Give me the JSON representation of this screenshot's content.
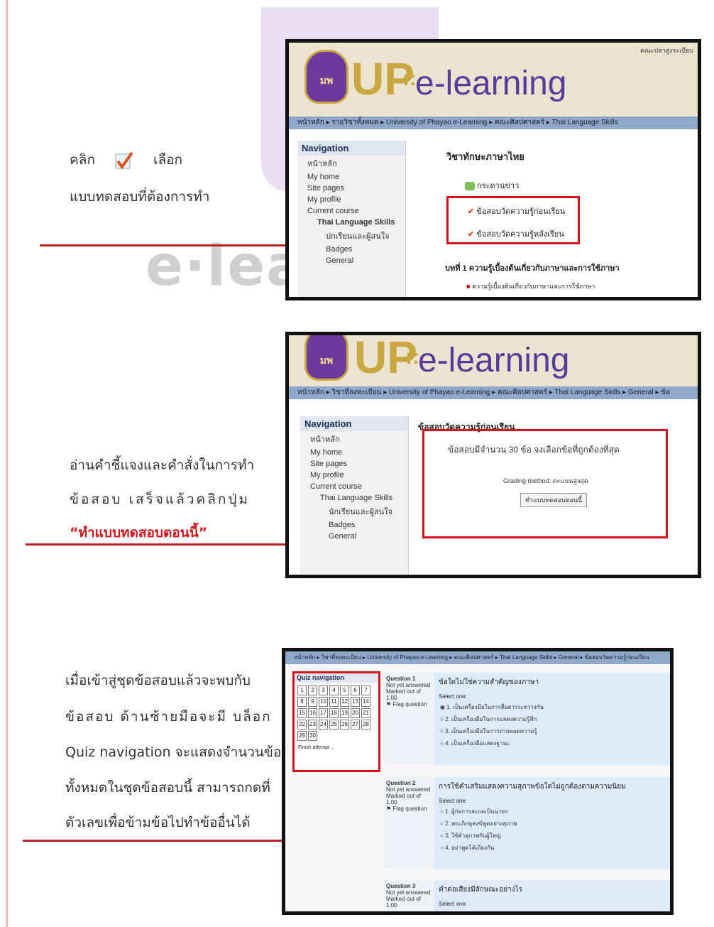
{
  "left_instructions": {
    "step1": {
      "line1_a": "คลิก",
      "line1_b": "เลือก",
      "line2": "แบบทดสอบที่ต้องการทำ"
    },
    "step2": {
      "line1": "อ่านคำชี้แจงและคำสั่งในการทำ",
      "line2": "ข้อสอบ เสร็จแล้วคลิกปุ่ม",
      "line3": "“ทำแบบทดสอบตอนนี้”"
    },
    "step3": {
      "line1": "เมื่อเข้าสู่ชุดข้อสอบแล้วจะพบกับ",
      "line2": "ข้อสอบ ด้านซ้ายมือจะมี บล็อก",
      "line3": "Quiz navigation จะแสดงจำนวนข้อ",
      "line4": "ทั้งหมดในชุดข้อสอบนี้ สามารถกดที่",
      "line5": "ตัวเลขเพื่อข้ามข้อไปทำข้ออื่นได้"
    }
  },
  "watermark": "e·lea",
  "colors": {
    "accent_red": "#d0141c",
    "nav_blue": "#8fa7c9",
    "logo_gold": "#c9a640",
    "logo_purple": "#5a3a9a"
  },
  "shot1": {
    "logo": {
      "up": "UP",
      "sep": "::",
      "el": "e-learning",
      "seal": "มพ"
    },
    "top_right": "คณะปลาสูงระเบียบ",
    "breadcrumb": "หน้าหลัก ▸ รายวิชาทั้งหมด ▸ University of Phayao e-Learning ▸ คณะศิลปศาสตร์ ▸ Thai Language Skills",
    "nav_title": "Navigation",
    "nav_items": [
      "หน้าหลัก",
      "My home",
      "Site pages",
      "My profile",
      "Current course",
      "Thai Language Skills",
      "ปกเรียนและผู้สนใจ",
      "Badges",
      "General"
    ],
    "course_title": "วิชาทักษะภาษาไทย",
    "news": "กระดานข่าว",
    "quiz1": "ข้อสอบวัดความรู้ก่อนเรียน",
    "quiz2": "ข้อสอบวัดความรู้หลังเรียน",
    "lesson": "บทที่ 1 ความรู้เบื้องต้นเกี่ยวกับภาษาและการใช้ภาษา",
    "lesson_item": "ความรู้เบื้องต้นเกี่ยวกับภาษาและการใช้ภาษา"
  },
  "shot2": {
    "logo": {
      "up": "UP",
      "sep": "::",
      "el": "e-learning",
      "seal": "มพ"
    },
    "breadcrumb": "หน้าหลัก ▸ วิชาที่ลงทะเบียน ▸ University of Phayao e-Learning ▸ คณะศิลปศาสตร์ ▸ Thai Language Skills ▸ General ▸ ข้อ",
    "nav_title": "Navigation",
    "nav_items": [
      "หน้าหลัก",
      "My home",
      "Site pages",
      "My profile",
      "Current course",
      "Thai Language Skills",
      "นักเรียนและผู้สนใจ",
      "Badges",
      "General"
    ],
    "quiz_title": "ข้อสอบวัดความรู้ก่อนเรียน",
    "desc": "ข้อสอบมีจำนวน 30 ข้อ จงเลือกข้อที่ถูกต้องที่สุด",
    "grading": "Grading method: คะแนนสูงสุด",
    "attempt_btn": "ทำแบบทดสอบตอนนี้"
  },
  "shot3": {
    "breadcrumb": "หน้าหลัก ▸ วิชาที่ลงทะเบียน ▸ University of Phayao e-Learning ▸ คณะศิลปศาสตร์ ▸ Thai Language Skills ▸ General ▸ ข้อสอบวัดความรู้ก่อนเรียน",
    "qnav_title": "Quiz navigation",
    "qnav_numbers": [
      "1",
      "2",
      "3",
      "4",
      "5",
      "6",
      "7",
      "8",
      "9",
      "10",
      "11",
      "12",
      "13",
      "14",
      "15",
      "16",
      "17",
      "18",
      "19",
      "20",
      "21",
      "22",
      "23",
      "24",
      "25",
      "26",
      "27",
      "28",
      "29",
      "30"
    ],
    "finish": "Finish attempt ...",
    "questions": [
      {
        "label": "Question 1",
        "status": "Not yet answered",
        "marked": "Marked out of 1.00",
        "flag": "Flag question",
        "text": "ข้อใดไม่ใช่ความสำคัญของภาษา",
        "select": "Select one:",
        "options": [
          "1. เป็นเครื่องมือในการสื่อสารระหว่างกัน",
          "2. เป็นเครื่องมือในการแสดงความรู้สึก",
          "3. เป็นเครื่องมือในการถ่ายทอดความรู้",
          "4. เป็นเครื่องมือแสดงฐานะ"
        ]
      },
      {
        "label": "Question 2",
        "status": "Not yet answered",
        "marked": "Marked out of 1.00",
        "flag": "Flag question",
        "text": "การใช้คำเสริมแสดงความสุภาพข้อใดไม่ถูกต้องตามความนิยม",
        "select": "Select one:",
        "options": [
          "1. ผู้ก่อการสะกดเป็นนายก",
          "2. พระภิกษุสงฆ์พูดอย่างสุภาพ",
          "3. ใช้คำสุภาพกับผู้ใหญ่",
          "4. อย่าพูดโต้เถียงกัน"
        ]
      },
      {
        "label": "Question 3",
        "status": "Not yet answered",
        "marked": "Marked out of 1.00",
        "text": "คำต่อเสียงมีลักษณะอย่างไร",
        "select": "Select one:"
      }
    ]
  }
}
